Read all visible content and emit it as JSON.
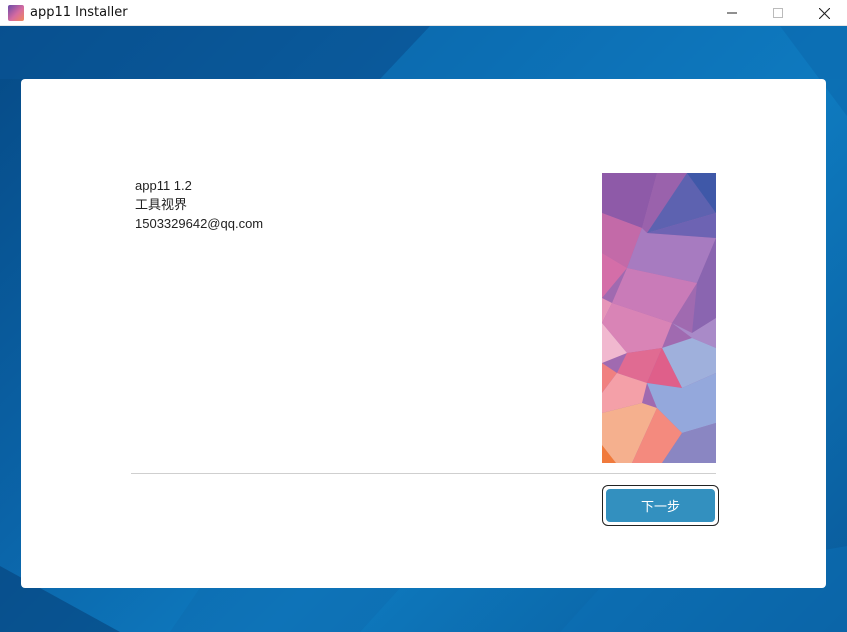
{
  "window": {
    "title": "app11 Installer"
  },
  "info": {
    "version_line": "app11 1.2",
    "author_line": "工具视界",
    "email_line": "1503329642@qq.com"
  },
  "footer": {
    "next_label": "下一步"
  },
  "colors": {
    "accent_button": "#3390bf",
    "desktop_blue": "#0b64a8"
  }
}
